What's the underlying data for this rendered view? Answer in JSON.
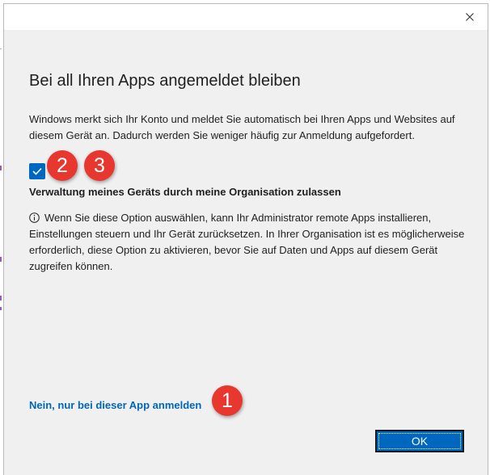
{
  "dialog": {
    "heading": "Bei all Ihren Apps angemeldet bleiben",
    "description": "Windows merkt sich Ihr Konto und meldet Sie automatisch bei Ihren Apps und Websites auf diesem Gerät an. Dadurch werden Sie weniger häufig zur Anmeldung aufgefordert.",
    "checkbox": {
      "checked": true,
      "label": "Verwaltung meines Geräts durch meine Organisation zulassen"
    },
    "info_text": "Wenn Sie diese Option auswählen, kann Ihr Administrator remote Apps installieren, Einstellungen steuern und Ihr Gerät zurücksetzen. In Ihrer Organisation ist es möglicherweise erforderlich, diese Option zu aktivieren, bevor Sie auf Daten und Apps auf diesem Gerät zugreifen können.",
    "link": "Nein, nur bei dieser App anmelden",
    "ok_button": "OK",
    "close_icon": "close-icon",
    "accent_color": "#0067c0",
    "link_color": "#0067b8"
  },
  "annotations": {
    "badge_1": "1",
    "badge_2": "2",
    "badge_3": "3",
    "badge_color": "#e8372f"
  }
}
